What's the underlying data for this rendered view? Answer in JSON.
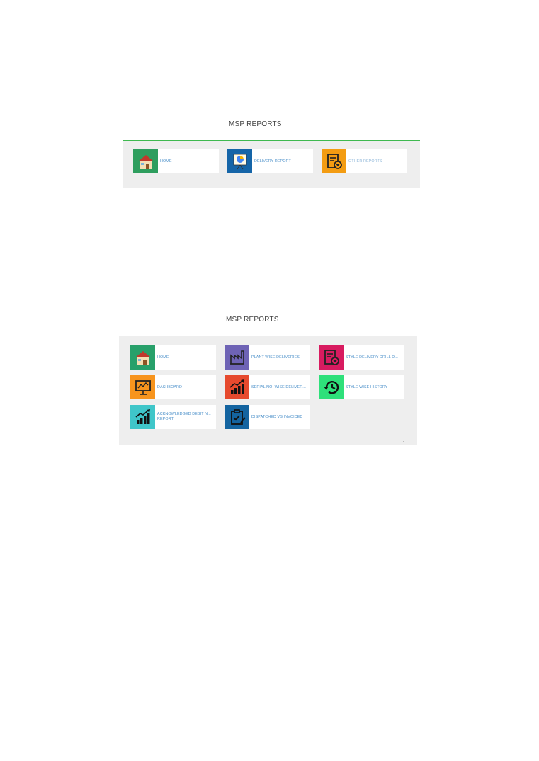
{
  "screen1": {
    "title": "MSP REPORTS",
    "tiles": [
      {
        "label": "HOME",
        "icon": "house-icon",
        "color": "#2e9e5e"
      },
      {
        "label": "DELIVERY REPORT",
        "icon": "presentation-chart-icon",
        "color": "#1565a8"
      },
      {
        "label": "OTHER REPORTS",
        "icon": "document-settings-icon",
        "color": "#f39c12"
      }
    ]
  },
  "screen2": {
    "title": "MSP REPORTS",
    "tiles": [
      {
        "label": "HOME",
        "icon": "house-icon",
        "color": "#27a06a"
      },
      {
        "label": "PLANT WISE DELIVERIES",
        "icon": "factory-icon",
        "color": "#6e63b5"
      },
      {
        "label": "STYLE DELIVERY DRILL D...",
        "icon": "document-settings-icon",
        "color": "#d81b60"
      },
      {
        "label": "DASHBOARD",
        "icon": "presentation-chart-icon",
        "color": "#f7941d"
      },
      {
        "label": "SERIAL NO. WISE DELIVER...",
        "icon": "bar-chart-up-icon",
        "color": "#e64a2e"
      },
      {
        "label": "STYLE WISE HISTORY",
        "icon": "history-icon",
        "color": "#2ee07a"
      },
      {
        "label": "ACKNOWLEDGED DEBIT N... REPORT",
        "icon": "bar-chart-up-icon",
        "color": "#3fc6c9"
      },
      {
        "label": "DISPATCHED VS INVOICED",
        "icon": "clipboard-check-icon",
        "color": "#1464a0"
      }
    ]
  }
}
